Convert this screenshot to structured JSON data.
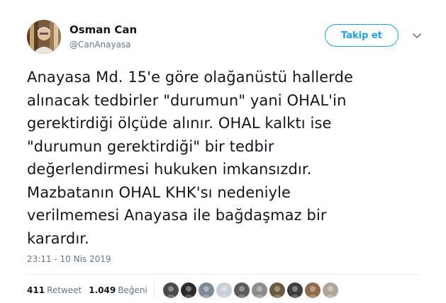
{
  "author": {
    "name": "Osman Can",
    "handle": "@CanAnayasa"
  },
  "follow_button": {
    "label": "Takip et"
  },
  "icons": {
    "caret": "chevron-down-icon"
  },
  "tweet_lines": [
    "Anayasa Md. 15'e göre olağanüstü hallerde",
    "alınacak tedbirler \"durumun\" yani OHAL'in",
    "gerektirdiği ölçüde alınır. OHAL kalktı ise",
    "\"durumun gerektirdiği\" bir tedbir",
    "değerlendirmesi hukuken imkansızdır.",
    "Mazbatanın OHAL KHK'sı nedeniyle",
    "verilmemesi Anayasa ile bağdaşmaz bir",
    "karardır."
  ],
  "timestamp": "23:11 - 10 Nis 2019",
  "stats": {
    "retweets_count": "411",
    "retweets_label": "Retweet",
    "likes_count": "1.049",
    "likes_label": "Beğeni"
  },
  "colors": {
    "accent": "#1da1f2",
    "text": "#14171a",
    "muted": "#657786",
    "divider": "#e6ecf0"
  },
  "likers": [
    {
      "color": "#4a4a4a"
    },
    {
      "color": "#2b2b2b"
    },
    {
      "color": "#7d8a96"
    },
    {
      "color": "#c8d0d6"
    },
    {
      "color": "#5c5c5c"
    },
    {
      "color": "#8c8c8c"
    },
    {
      "color": "#6b5a3e"
    },
    {
      "color": "#3d3d3d"
    },
    {
      "color": "#8f6b4a"
    },
    {
      "color": "#b0a79a"
    }
  ]
}
